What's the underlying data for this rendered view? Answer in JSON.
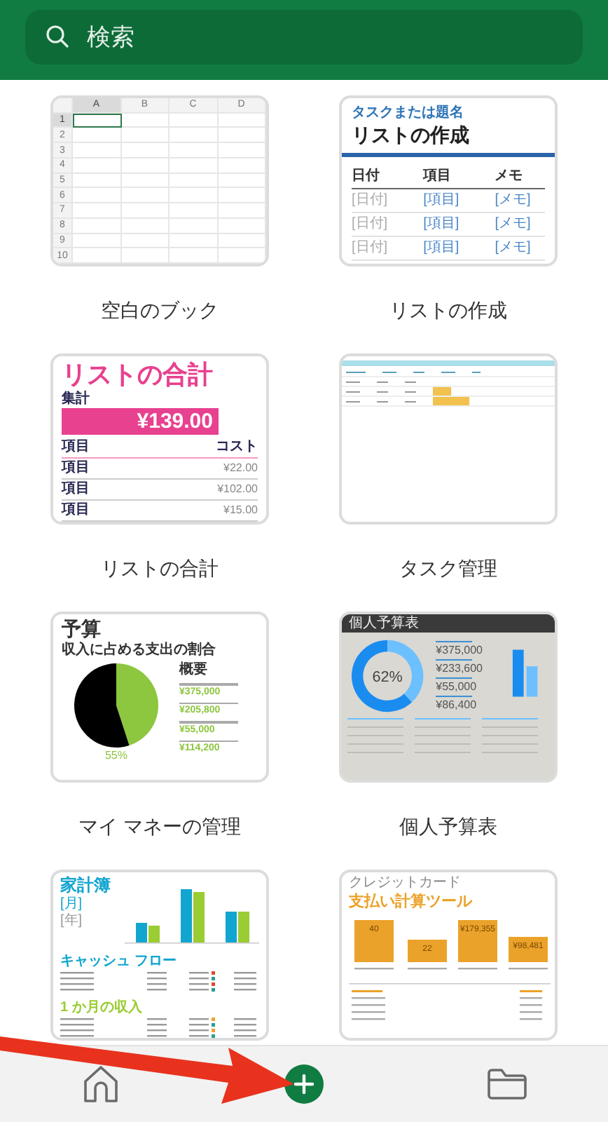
{
  "search": {
    "placeholder": "検索"
  },
  "templates": [
    {
      "kind": "blank",
      "title": "空白のブック",
      "preview": {
        "columns": [
          {
            "label": "A",
            "selected": true
          },
          {
            "label": "B",
            "selected": false
          },
          {
            "label": "C",
            "selected": false
          },
          {
            "label": "D",
            "selected": false
          }
        ],
        "rows": [
          {
            "label": "1",
            "selected": true
          },
          {
            "label": "2",
            "selected": false
          },
          {
            "label": "3",
            "selected": false
          },
          {
            "label": "4",
            "selected": false
          },
          {
            "label": "5",
            "selected": false
          },
          {
            "label": "6",
            "selected": false
          },
          {
            "label": "7",
            "selected": false
          },
          {
            "label": "8",
            "selected": false
          },
          {
            "label": "9",
            "selected": false
          },
          {
            "label": "10",
            "selected": false
          }
        ]
      }
    },
    {
      "kind": "list",
      "title": "リストの作成",
      "preview": {
        "subtitle": "タスクまたは題名",
        "heading": "リストの作成",
        "columns": [
          "日付",
          "項目",
          "メモ"
        ],
        "rows": [
          [
            "[日付]",
            "[項目]",
            "[メモ]"
          ],
          [
            "[日付]",
            "[項目]",
            "[メモ]"
          ],
          [
            "[日付]",
            "[項目]",
            "[メモ]"
          ]
        ]
      }
    },
    {
      "kind": "total",
      "title": "リストの合計",
      "preview": {
        "heading": "リストの合計",
        "total_label": "集計",
        "total": "¥139.00",
        "columns": [
          "項目",
          "コスト"
        ],
        "rows": [
          [
            "項目",
            "¥22.00"
          ],
          [
            "項目",
            "¥102.00"
          ],
          [
            "項目",
            "¥15.00"
          ]
        ]
      }
    },
    {
      "kind": "tasks",
      "title": "タスク管理",
      "preview": {
        "rows": [
          {
            "kind": "task"
          },
          {
            "kind": "task"
          },
          {
            "kind": "task"
          }
        ]
      }
    },
    {
      "kind": "budget",
      "title": "マイ マネーの管理",
      "preview": {
        "heading": "予算",
        "chart_title": "収入に占める支出の割合",
        "chart_data": {
          "type": "pie",
          "values": [
            45,
            55
          ]
        },
        "percent": "55%",
        "summary_heading": "概要",
        "summary_values": [
          "¥375,000",
          "¥205,800",
          "¥55,000",
          "¥114,200"
        ]
      }
    },
    {
      "kind": "personal",
      "title": "個人予算表",
      "preview": {
        "heading": "個人予算表",
        "chart_data": {
          "type": "donut",
          "values": [
            62,
            38
          ]
        },
        "percent": "62%",
        "values": [
          "¥375,000",
          "¥233,600",
          "¥55,000",
          "¥86,400"
        ]
      }
    },
    {
      "kind": "household",
      "preview": {
        "heading": "家計簿",
        "month": "[月]",
        "year": "[年]",
        "sections": [
          "キャッシュ フロー",
          "1 か月の収入"
        ]
      }
    },
    {
      "kind": "payment",
      "preview": {
        "caption": "クレジットカード",
        "heading": "支払い計算ツール",
        "bars": [
          "40",
          "22",
          "¥179,355",
          "¥98,481"
        ]
      }
    }
  ]
}
